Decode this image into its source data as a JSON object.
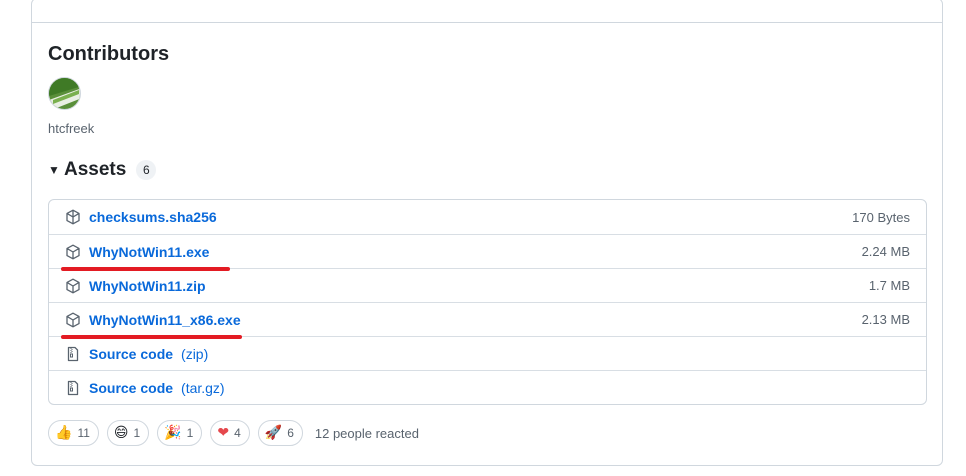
{
  "contributors": {
    "title": "Contributors",
    "name": "htcfreek"
  },
  "assets": {
    "title": "Assets",
    "count": "6",
    "rows": [
      {
        "name": "checksums.sha256",
        "size": "170 Bytes",
        "icon": "package-icon"
      },
      {
        "name": "WhyNotWin11.exe",
        "size": "2.24 MB",
        "icon": "package-icon"
      },
      {
        "name": "WhyNotWin11.zip",
        "size": "1.7 MB",
        "icon": "package-icon"
      },
      {
        "name": "WhyNotWin11_x86.exe",
        "size": "2.13 MB",
        "icon": "package-icon"
      },
      {
        "name": "Source code",
        "ext": "(zip)",
        "icon": "file-zip-icon"
      },
      {
        "name": "Source code",
        "ext": "(tar.gz)",
        "icon": "file-zip-icon"
      }
    ]
  },
  "reactions": {
    "items": [
      {
        "emoji": "👍",
        "count": "11",
        "name": "thumbs-up"
      },
      {
        "emoji": "😄",
        "count": "1",
        "name": "laugh"
      },
      {
        "emoji": "🎉",
        "count": "1",
        "name": "hooray"
      },
      {
        "emoji": "❤",
        "count": "4",
        "name": "heart"
      },
      {
        "emoji": "🚀",
        "count": "6",
        "name": "rocket"
      }
    ],
    "summary": "12 people reacted"
  },
  "colors": {
    "link": "#0969da",
    "highlight": "#e31b23",
    "border": "#d0d7de"
  }
}
